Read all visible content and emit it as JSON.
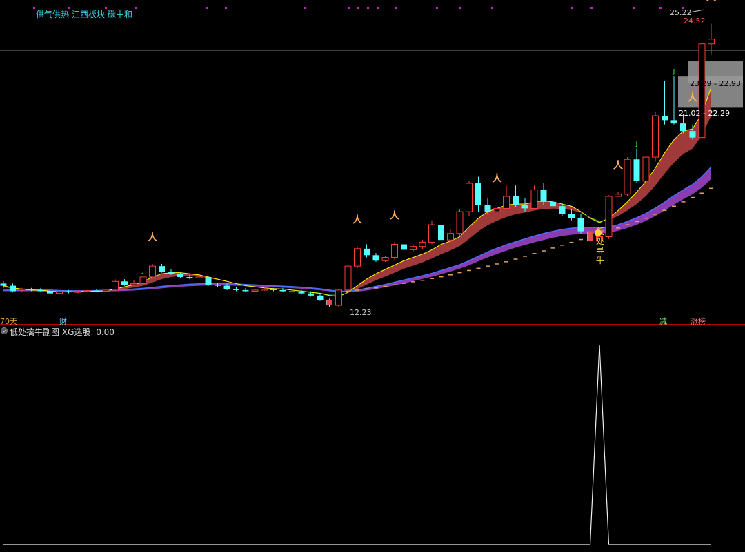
{
  "header_tags": [
    "供气供热",
    "江西板块",
    "碳中和"
  ],
  "period_label": "70天",
  "finance_label": "财",
  "reduce_label": "减",
  "limit_up_label": "涨榜",
  "signal_text": [
    "低",
    "处",
    "寻",
    "牛"
  ],
  "indicator": {
    "name": "低处擒牛副图",
    "readout": "XG选股: 0.00"
  },
  "colors": {
    "up": "#ff3c3c",
    "down": "#54ffff",
    "ma_fast": "#ffff00",
    "ma_mid": "#ff4dff",
    "ribbon_up": "#a03a3a",
    "ribbon_down": "#2e8b2e",
    "slow_ribbon": "#8a3cb0",
    "support": "#e0a060",
    "tag": "#3fd3e8"
  },
  "chart_data": {
    "type": "candlestick",
    "title": "",
    "price_labels": {
      "max": "25.22",
      "last": "24.52",
      "zone_upper": "23.29 - 22.93",
      "zone_lower": "21.02 - 22.29",
      "min": "12.23"
    },
    "ylim": [
      11.7,
      26.0
    ],
    "candles": [
      [
        13.3,
        13.4,
        13.1,
        13.2
      ],
      [
        13.2,
        13.3,
        12.9,
        12.95
      ],
      [
        13.0,
        13.1,
        12.9,
        13.05
      ],
      [
        13.05,
        13.1,
        12.95,
        13.0
      ],
      [
        13.0,
        13.1,
        12.9,
        12.95
      ],
      [
        12.95,
        13.05,
        12.8,
        12.85
      ],
      [
        12.85,
        13.0,
        12.8,
        12.95
      ],
      [
        12.95,
        13.0,
        12.85,
        12.9
      ],
      [
        12.9,
        13.0,
        12.85,
        12.95
      ],
      [
        12.95,
        13.0,
        12.9,
        12.98
      ],
      [
        12.98,
        13.05,
        12.9,
        12.95
      ],
      [
        12.95,
        13.0,
        12.9,
        13.0
      ],
      [
        13.0,
        13.5,
        12.95,
        13.4
      ],
      [
        13.4,
        13.5,
        13.2,
        13.25
      ],
      [
        13.25,
        13.45,
        13.2,
        13.3
      ],
      [
        13.3,
        13.7,
        13.25,
        13.6
      ],
      [
        13.6,
        14.2,
        13.6,
        14.1
      ],
      [
        14.1,
        14.2,
        13.8,
        13.85
      ],
      [
        13.85,
        13.95,
        13.7,
        13.75
      ],
      [
        13.75,
        13.8,
        13.55,
        13.6
      ],
      [
        13.6,
        13.7,
        13.5,
        13.55
      ],
      [
        13.55,
        13.6,
        13.5,
        13.6
      ],
      [
        13.6,
        13.65,
        13.2,
        13.25
      ],
      [
        13.25,
        13.35,
        13.15,
        13.2
      ],
      [
        13.2,
        13.3,
        13.0,
        13.05
      ],
      [
        13.05,
        13.15,
        12.95,
        13.0
      ],
      [
        13.0,
        13.1,
        12.9,
        12.95
      ],
      [
        12.95,
        13.05,
        12.9,
        13.0
      ],
      [
        13.0,
        13.15,
        12.95,
        13.05
      ],
      [
        13.05,
        13.1,
        12.95,
        13.0
      ],
      [
        13.0,
        13.1,
        12.9,
        12.95
      ],
      [
        12.95,
        13.05,
        12.85,
        12.9
      ],
      [
        12.9,
        13.0,
        12.8,
        12.85
      ],
      [
        12.85,
        12.95,
        12.7,
        12.75
      ],
      [
        12.75,
        12.8,
        12.5,
        12.55
      ],
      [
        12.55,
        12.6,
        12.23,
        12.3
      ],
      [
        12.3,
        13.05,
        12.23,
        13.0
      ],
      [
        13.0,
        14.25,
        12.95,
        14.1
      ],
      [
        14.1,
        15.0,
        14.0,
        14.9
      ],
      [
        14.9,
        15.1,
        14.5,
        14.6
      ],
      [
        14.6,
        14.7,
        14.3,
        14.35
      ],
      [
        14.35,
        14.55,
        14.3,
        14.5
      ],
      [
        14.5,
        15.2,
        14.4,
        15.1
      ],
      [
        15.1,
        15.5,
        14.8,
        14.85
      ],
      [
        14.85,
        15.1,
        14.75,
        15.0
      ],
      [
        15.0,
        15.3,
        14.9,
        15.2
      ],
      [
        15.2,
        16.2,
        15.1,
        16.0
      ],
      [
        16.0,
        16.5,
        15.2,
        15.3
      ],
      [
        15.3,
        15.8,
        15.2,
        15.6
      ],
      [
        15.6,
        16.7,
        15.5,
        16.6
      ],
      [
        16.6,
        18.0,
        16.4,
        17.9
      ],
      [
        17.9,
        18.2,
        16.6,
        16.9
      ],
      [
        16.9,
        17.2,
        16.5,
        16.6
      ],
      [
        16.6,
        16.9,
        16.4,
        16.75
      ],
      [
        16.75,
        17.8,
        16.7,
        17.3
      ],
      [
        17.3,
        17.8,
        16.8,
        16.9
      ],
      [
        16.9,
        17.2,
        16.6,
        16.75
      ],
      [
        16.75,
        17.8,
        16.7,
        17.6
      ],
      [
        17.6,
        17.9,
        16.9,
        17.05
      ],
      [
        17.05,
        17.4,
        16.7,
        16.85
      ],
      [
        16.85,
        17.0,
        16.4,
        16.5
      ],
      [
        16.5,
        16.7,
        16.2,
        16.3
      ],
      [
        16.3,
        16.5,
        15.6,
        15.7
      ],
      [
        15.7,
        15.95,
        15.2,
        15.25
      ],
      [
        15.25,
        15.5,
        15.3,
        15.45
      ],
      [
        15.45,
        17.35,
        15.35,
        17.3
      ],
      [
        17.3,
        17.5,
        17.3,
        17.4
      ],
      [
        17.4,
        19.1,
        17.3,
        19.0
      ],
      [
        19.0,
        19.5,
        17.9,
        18.0
      ],
      [
        18.0,
        19.2,
        17.8,
        19.1
      ],
      [
        19.1,
        21.2,
        18.9,
        21.0
      ],
      [
        21.0,
        22.6,
        20.6,
        20.8
      ],
      [
        20.8,
        22.8,
        20.6,
        20.65
      ],
      [
        20.65,
        21.1,
        20.2,
        20.3
      ],
      [
        20.3,
        20.6,
        19.9,
        20.0
      ],
      [
        20.0,
        24.5,
        19.9,
        24.3
      ],
      [
        24.3,
        25.22,
        23.8,
        24.52
      ]
    ],
    "ma_fast": [
      13.2,
      13.1,
      13.05,
      13.0,
      13.0,
      12.95,
      12.93,
      12.92,
      12.93,
      12.95,
      12.95,
      12.97,
      13.05,
      13.15,
      13.25,
      13.38,
      13.6,
      13.75,
      13.8,
      13.8,
      13.75,
      13.7,
      13.6,
      13.5,
      13.4,
      13.3,
      13.2,
      13.15,
      13.1,
      13.07,
      13.05,
      13.0,
      12.95,
      12.9,
      12.85,
      12.75,
      12.7,
      12.9,
      13.2,
      13.5,
      13.75,
      13.95,
      14.15,
      14.35,
      14.5,
      14.65,
      14.85,
      15.1,
      15.25,
      15.45,
      15.9,
      16.3,
      16.6,
      16.75,
      16.9,
      16.95,
      16.95,
      17.05,
      17.1,
      17.05,
      16.95,
      16.85,
      16.6,
      16.3,
      16.1,
      16.3,
      16.65,
      17.05,
      17.5,
      18.0,
      18.6,
      19.3,
      19.9,
      20.3,
      20.4,
      21.1,
      22.3
    ],
    "ribbon_lower": [
      13.15,
      13.05,
      13.0,
      12.95,
      12.95,
      12.93,
      12.92,
      12.92,
      12.93,
      12.95,
      12.95,
      12.96,
      13.0,
      13.05,
      13.12,
      13.2,
      13.35,
      13.5,
      13.6,
      13.65,
      13.65,
      13.62,
      13.55,
      13.47,
      13.38,
      13.3,
      13.22,
      13.15,
      13.1,
      13.07,
      13.05,
      13.02,
      12.98,
      12.93,
      12.88,
      12.8,
      12.78,
      12.88,
      13.05,
      13.25,
      13.45,
      13.62,
      13.8,
      13.98,
      14.12,
      14.27,
      14.45,
      14.65,
      14.82,
      15.02,
      15.35,
      15.7,
      15.98,
      16.18,
      16.35,
      16.48,
      16.56,
      16.65,
      16.72,
      16.74,
      16.72,
      16.67,
      16.55,
      16.35,
      16.18,
      16.22,
      16.4,
      16.65,
      16.95,
      17.32,
      17.8,
      18.35,
      18.85,
      19.25,
      19.5,
      20.1,
      21.0
    ],
    "slow_upper": [
      13.0,
      13.0,
      13.0,
      13.0,
      13.0,
      13.0,
      12.98,
      12.97,
      12.97,
      12.97,
      12.98,
      12.99,
      13.0,
      13.02,
      13.05,
      13.08,
      13.12,
      13.17,
      13.21,
      13.24,
      13.27,
      13.29,
      13.3,
      13.3,
      13.29,
      13.28,
      13.26,
      13.24,
      13.22,
      13.2,
      13.18,
      13.16,
      13.13,
      13.1,
      13.06,
      13.0,
      12.95,
      12.95,
      13.0,
      13.08,
      13.17,
      13.26,
      13.36,
      13.46,
      13.56,
      13.66,
      13.77,
      13.9,
      14.03,
      14.17,
      14.35,
      14.55,
      14.75,
      14.92,
      15.08,
      15.22,
      15.35,
      15.48,
      15.6,
      15.7,
      15.78,
      15.84,
      15.88,
      15.88,
      15.86,
      15.9,
      16.0,
      16.15,
      16.32,
      16.52,
      16.76,
      17.04,
      17.33,
      17.6,
      17.85,
      18.2,
      18.65
    ],
    "slow_lower": [
      12.95,
      12.95,
      12.95,
      12.95,
      12.95,
      12.95,
      12.93,
      12.92,
      12.92,
      12.92,
      12.93,
      12.94,
      12.95,
      12.96,
      12.98,
      13.01,
      13.04,
      13.08,
      13.12,
      13.15,
      13.18,
      13.2,
      13.21,
      13.22,
      13.21,
      13.2,
      13.19,
      13.17,
      13.15,
      13.13,
      13.11,
      13.09,
      13.06,
      13.03,
      12.99,
      12.94,
      12.9,
      12.9,
      12.93,
      12.98,
      13.05,
      13.13,
      13.22,
      13.31,
      13.41,
      13.51,
      13.61,
      13.73,
      13.85,
      13.98,
      14.14,
      14.32,
      14.5,
      14.66,
      14.81,
      14.95,
      15.07,
      15.19,
      15.3,
      15.4,
      15.48,
      15.54,
      15.58,
      15.6,
      15.6,
      15.63,
      15.72,
      15.85,
      16.0,
      16.18,
      16.4,
      16.65,
      16.92,
      17.17,
      17.4,
      17.7,
      18.1
    ],
    "support": [
      null,
      null,
      null,
      null,
      null,
      null,
      null,
      null,
      null,
      null,
      null,
      null,
      null,
      null,
      null,
      null,
      null,
      null,
      null,
      null,
      null,
      null,
      null,
      null,
      null,
      null,
      null,
      null,
      null,
      null,
      null,
      null,
      null,
      null,
      null,
      null,
      12.9,
      12.95,
      13.0,
      13.05,
      13.1,
      13.17,
      13.24,
      13.31,
      13.38,
      13.45,
      13.53,
      13.61,
      13.7,
      13.8,
      13.9,
      14.0,
      14.1,
      14.2,
      14.3,
      14.42,
      14.55,
      14.68,
      14.8,
      14.93,
      15.06,
      15.19,
      15.32,
      15.45,
      15.58,
      15.7,
      15.85,
      16.0,
      16.15,
      16.3,
      16.48,
      16.66,
      16.85,
      17.05,
      17.25,
      17.45,
      17.67
    ],
    "up_arrows": [
      16,
      38,
      42,
      53,
      66,
      74,
      76
    ],
    "j_marks": [
      15,
      68,
      72
    ],
    "signal_index": 64,
    "xg_values": [
      0,
      0,
      0,
      0,
      0,
      0,
      0,
      0,
      0,
      0,
      0,
      0,
      0,
      0,
      0,
      0,
      0,
      0,
      0,
      0,
      0,
      0,
      0,
      0,
      0,
      0,
      0,
      0,
      0,
      0,
      0,
      0,
      0,
      0,
      0,
      0,
      0,
      0,
      0,
      0,
      0,
      0,
      0,
      0,
      0,
      0,
      0,
      0,
      0,
      0,
      0,
      0,
      0,
      0,
      0,
      0,
      0,
      0,
      0,
      0,
      0,
      0,
      0,
      0,
      1,
      0,
      0,
      0,
      0,
      0,
      0,
      0,
      0,
      0,
      0,
      0,
      0
    ],
    "xg_ylim": [
      0,
      1.05
    ]
  }
}
